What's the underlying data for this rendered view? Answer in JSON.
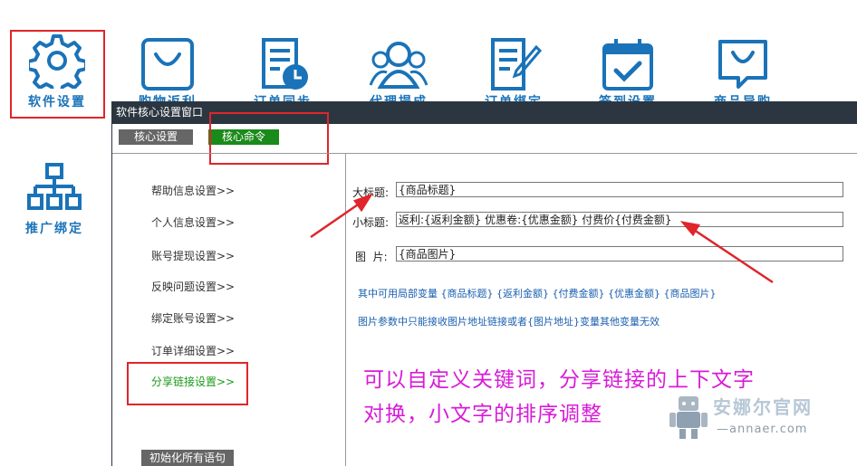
{
  "toolbar": {
    "tiles": [
      {
        "label": "软件设置",
        "icon": "gear-icon"
      },
      {
        "label": "购物返利",
        "icon": "shopping-bag-icon"
      },
      {
        "label": "订单同步",
        "icon": "order-clock-icon"
      },
      {
        "label": "代理提成",
        "icon": "users-icon"
      },
      {
        "label": "订单绑定",
        "icon": "document-pen-icon"
      },
      {
        "label": "签到设置",
        "icon": "calendar-check-icon"
      },
      {
        "label": "商品导购",
        "icon": "chat-bag-icon"
      }
    ],
    "promo": {
      "label": "推广绑定",
      "icon": "org-chart-icon"
    }
  },
  "window": {
    "title": "软件核心设置窗口",
    "tabs": [
      {
        "label": "核心设置",
        "color": "#666666"
      },
      {
        "label": "核心命令",
        "color": "#1a8a1a"
      }
    ],
    "menu": [
      {
        "label": "帮助信息设置>>"
      },
      {
        "label": "个人信息设置>>"
      },
      {
        "label": "账号提现设置>>"
      },
      {
        "label": "反映问题设置>>"
      },
      {
        "label": "绑定账号设置>>"
      },
      {
        "label": "订单详细设置>>"
      },
      {
        "label": "分享链接设置>>",
        "active": true
      }
    ],
    "init_button": "初始化所有语句",
    "fields": {
      "title_label": "大标题:",
      "title_value": "{商品标题}",
      "subtitle_label": "小标题:",
      "subtitle_value": "返利:{返利金额} 优惠卷:{优惠金额} 付费价{付费金额}",
      "image_label": "图  片:",
      "image_value": "{商品图片}"
    },
    "hints": [
      "其中可用局部变量 {商品标题} {返利金额} {付费金额} {优惠金额} {商品图片}",
      "图片参数中只能接收图片地址链接或者{图片地址}变量其他变量无效"
    ]
  },
  "annotation": {
    "line1": "可以自定义关键词，分享链接的上下文字",
    "line2": "对换，小文字的排序调整"
  },
  "watermark": {
    "name": "安娜尔官网",
    "url": "—annaer.com"
  },
  "colors": {
    "accent_blue": "#1a73b8",
    "highlight_red": "#e0252b",
    "annotation_magenta": "#d81bd8",
    "active_green": "#1a8a1a",
    "window_titlebar": "#2b3640"
  }
}
